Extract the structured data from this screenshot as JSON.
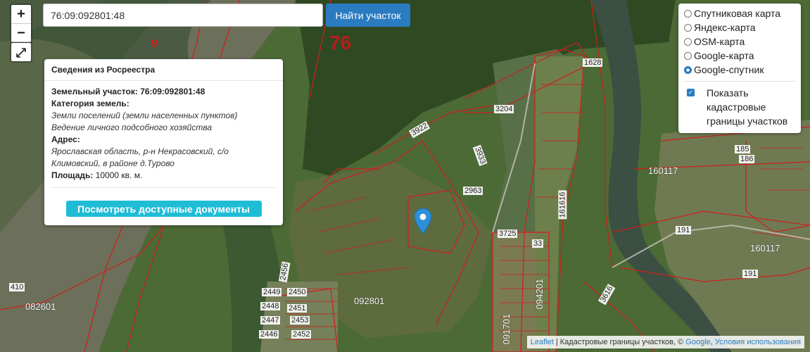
{
  "search": {
    "value": "76:09:092801:48",
    "button_label": "Найти участок"
  },
  "zoom": {
    "in_label": "+",
    "out_label": "−"
  },
  "fullscreen": {
    "icon": "expand-arrows-icon"
  },
  "info": {
    "title": "Сведения из Росреестра",
    "parcel_label": "Земельный участок:",
    "parcel_value": "76:09:092801:48",
    "category_label": "Категория земель:",
    "category_line1": "Земли поселений (земли населенных пунктов)",
    "category_line2": "Ведение личного подсобного хозяйства",
    "address_label": "Адрес:",
    "address_line1": "Ярославская область, р-н Некрасовский, с/о",
    "address_line2": "Климовский, в районе д.Турово",
    "area_label": "Площадь:",
    "area_value": "10000 кв. м.",
    "docs_button": "Посмотреть доступные документы"
  },
  "layers": {
    "options": [
      "Спутниковая карта",
      "Яндекс-карта",
      "OSM-карта",
      "Google-карта",
      "Google-спутник"
    ],
    "selected": "Google-спутник",
    "cadastral_toggle": "Показать кадастровые границы участков",
    "cadastral_checked": true
  },
  "attribution": {
    "leaflet": "Leaflet",
    "text": " | Кадастровые границы участков, © ",
    "google": "Google",
    "terms": "Условия использования"
  },
  "map_labels": {
    "region": "76",
    "l9": "9",
    "l1628": "1628",
    "l3204": "3204",
    "l3922": "3922",
    "l3933": "3933",
    "l2963": "2963",
    "l3725": "3725",
    "l160117a": "160117",
    "l160117b": "160117",
    "l092801": "092801",
    "l082601": "082601",
    "l094201": "094201",
    "l091701": "091701",
    "l410": "410",
    "l191a": "191",
    "l191b": "191",
    "l2449": "2449",
    "l2450": "2450",
    "l2448": "2448",
    "l2451": "2451",
    "l2447": "2447",
    "l2453": "2453",
    "l2446": "2446",
    "l2452": "2452",
    "l2456": "2456",
    "l185": "185",
    "l186": "186",
    "l1616": "161616",
    "l33": "33",
    "l3616": "3616"
  }
}
